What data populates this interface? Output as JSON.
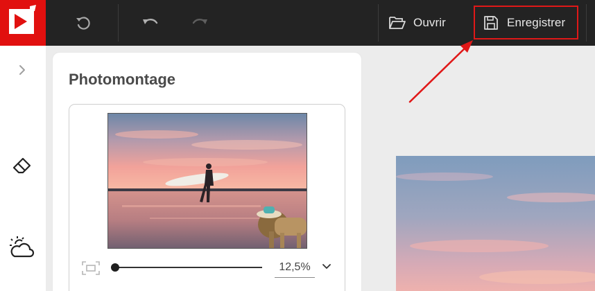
{
  "toolbar": {
    "reset_icon": "rotate-left-icon",
    "undo_icon": "undo-icon",
    "redo_icon": "redo-icon",
    "open_label": "Ouvrir",
    "open_icon": "folder-open-icon",
    "save_label": "Enregistrer",
    "save_icon": "floppy-disk-icon",
    "highlight_color": "#e01818"
  },
  "sidebar": {
    "expand_icon": "chevron-right-icon",
    "items": [
      {
        "icon": "eraser-icon"
      },
      {
        "icon": "sun-cloud-icon"
      }
    ]
  },
  "panel": {
    "title": "Photomontage",
    "zoom": {
      "value_label": "12,5%",
      "slider_level": 0.0
    }
  },
  "colors": {
    "brand": "#e1100f",
    "topbar": "#232323",
    "canvas_bg": "#ececec"
  }
}
